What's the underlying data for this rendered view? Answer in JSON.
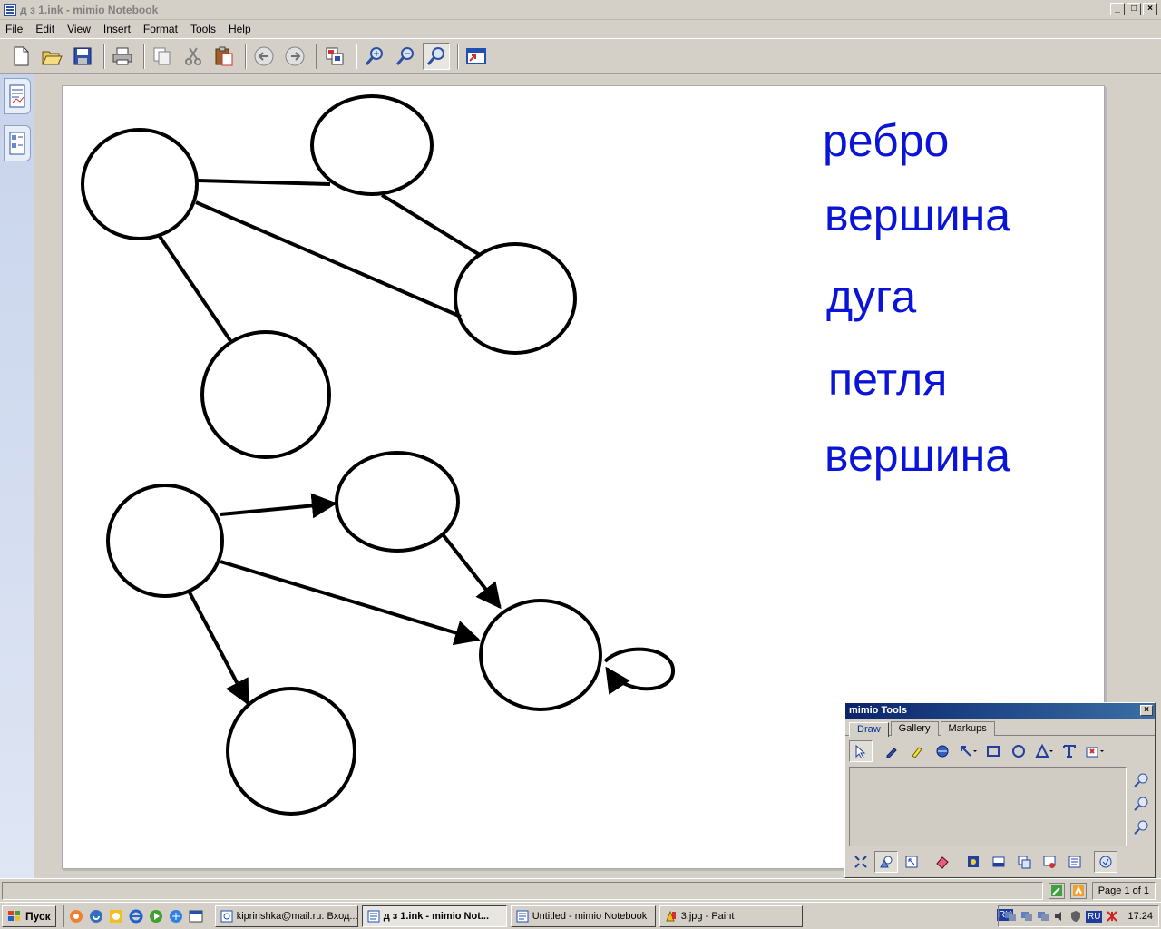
{
  "window": {
    "title": "д з 1.ink - mimio Notebook",
    "btn_min": "_",
    "btn_max": "□",
    "btn_close": "×"
  },
  "menu": [
    "File",
    "Edit",
    "View",
    "Insert",
    "Format",
    "Tools",
    "Help"
  ],
  "toolbar": {
    "buttons": [
      "new-icon",
      "open-icon",
      "save-icon",
      "print-icon",
      "copy-icon",
      "cut-icon",
      "paste-icon",
      "back-icon",
      "forward-icon",
      "page-icon",
      "zoom-in-icon",
      "zoom-out-icon",
      "zoom-fit-icon",
      "window-icon"
    ],
    "pressed": "zoom-fit-icon"
  },
  "words": [
    "ребро",
    "вершина",
    "дуга",
    "петля",
    "вершина"
  ],
  "colors": {
    "word": "#0a14d6",
    "graph": "#000000",
    "title_bar": "#0a246a"
  },
  "tools_panel": {
    "title": "mimio Tools",
    "close": "×",
    "tabs": [
      "Draw",
      "Gallery",
      "Markups"
    ],
    "active_tab": "Draw",
    "tools": [
      "select-icon",
      "pen-icon",
      "highlighter-icon",
      "fill-icon",
      "line-icon",
      "rectangle-icon",
      "ellipse-icon",
      "triangle-icon",
      "text-icon",
      "stamp-icon"
    ],
    "side": [
      "zoom-in-icon",
      "zoom-out-icon",
      "zoom-reset-icon"
    ],
    "bottom": [
      "fit-icon",
      "shape-icon",
      "resize-icon",
      "eraser-icon",
      "image-icon",
      "screen-icon",
      "capture-icon",
      "record-icon",
      "notes-icon",
      "mimio-icon"
    ]
  },
  "status": {
    "page": "Page 1 of 1"
  },
  "taskbar": {
    "start": "Пуск",
    "tasks": [
      {
        "label": "kipririshka@mail.ru: Вход...",
        "active": false
      },
      {
        "label": "д з 1.ink - mimio Not...",
        "active": true
      },
      {
        "label": "Untitled - mimio Notebook",
        "active": false
      },
      {
        "label": "3.jpg - Paint",
        "active": false
      }
    ],
    "lang": "RU",
    "tray_lang": "RU",
    "clock": "17:24"
  }
}
